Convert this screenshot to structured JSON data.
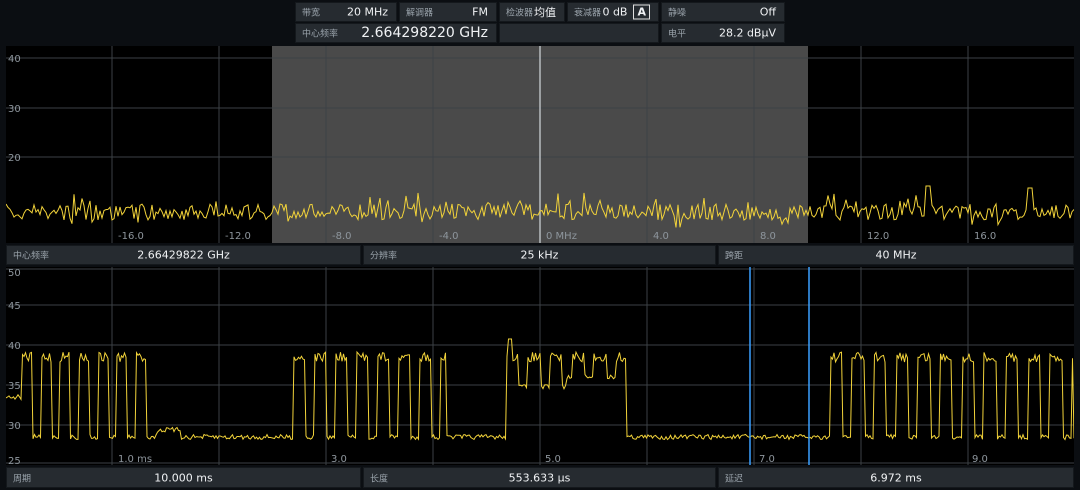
{
  "top_bar": {
    "bandwidth": {
      "label": "带宽",
      "value": "20 MHz"
    },
    "demod": {
      "label": "解调器",
      "value": "FM"
    },
    "detector": {
      "label": "检波器",
      "value": "均值"
    },
    "attenuator": {
      "label": "衰减器",
      "value": "0 dB",
      "mode": "A"
    },
    "squelch": {
      "label": "静噪",
      "value": "Off"
    },
    "center_freq": {
      "label": "中心频率",
      "value": "2.664298220 GHz"
    },
    "blank": "",
    "level": {
      "label": "电平",
      "value": "28.2 dBµV"
    }
  },
  "spectrum": {
    "y_ticks": [
      "40",
      "30",
      "20"
    ],
    "x_ticks": [
      "-16.0",
      "-12.0",
      "-8.0",
      "-4.0",
      "0 MHz",
      "4.0",
      "8.0",
      "12.0",
      "16.0"
    ],
    "highlight_band_mhz": [
      -10,
      10
    ]
  },
  "mid_bar": {
    "center_freq": {
      "label": "中心频率",
      "value": "2.66429822 GHz"
    },
    "rbw": {
      "label": "分辨率",
      "value": "25 kHz"
    },
    "span": {
      "label": "跨距",
      "value": "40 MHz"
    }
  },
  "timeline": {
    "y_ticks": [
      "50",
      "45",
      "40",
      "35",
      "30",
      "25"
    ],
    "x_ticks": [
      "1.0 ms",
      "3.0",
      "5.0",
      "7.0",
      "9.0"
    ]
  },
  "bottom_bar": {
    "period": {
      "label": "周期",
      "value": "10.000 ms"
    },
    "length": {
      "label": "长度",
      "value": "553.633 µs"
    },
    "delay": {
      "label": "延迟",
      "value": "6.972 ms"
    }
  },
  "colors": {
    "trace": "#f2d33a",
    "marker": "#3aa0ff",
    "grid": "#3c4146",
    "band": "#4a4a4a"
  }
}
